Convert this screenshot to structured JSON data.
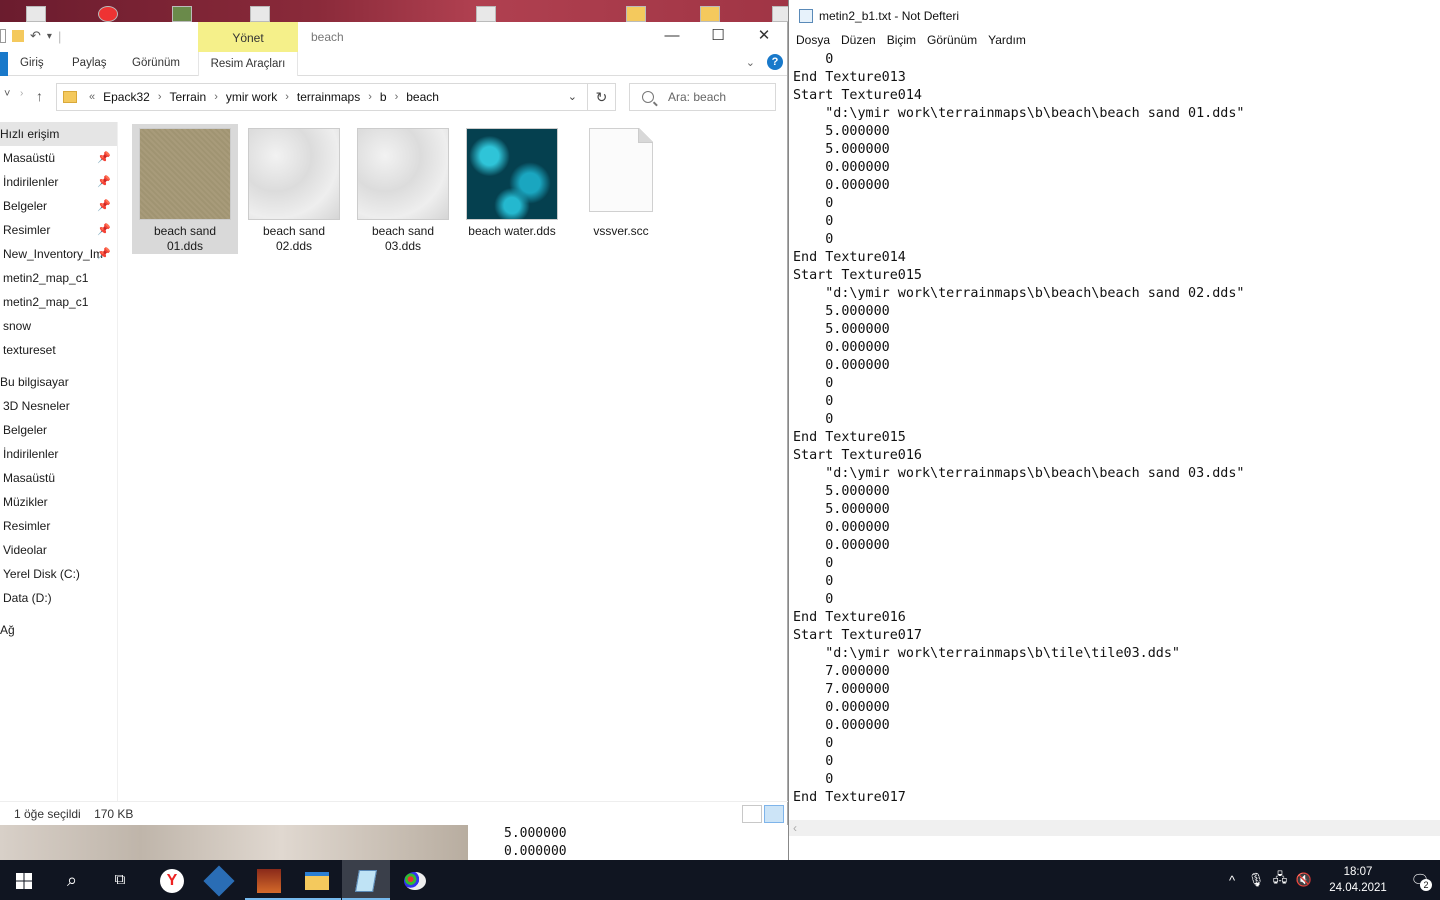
{
  "explorer": {
    "context_tab": "Yönet",
    "window_title": "beach",
    "ribbon_tabs": [
      "Giriş",
      "Paylaş",
      "Görünüm"
    ],
    "context_subtab": "Resim Araçları",
    "breadcrumbs": [
      "Epack32",
      "Terrain",
      "ymir work",
      "terrainmaps",
      "b",
      "beach"
    ],
    "search_placeholder": "Ara: beach",
    "nav_items": [
      {
        "label": "Hızlı erişim",
        "pinned": false,
        "selected": true
      },
      {
        "label": "Masaüstü",
        "pinned": true
      },
      {
        "label": "İndirilenler",
        "pinned": true
      },
      {
        "label": "Belgeler",
        "pinned": true
      },
      {
        "label": "Resimler",
        "pinned": true
      },
      {
        "label": "New_Inventory_Im",
        "pinned": true
      },
      {
        "label": "metin2_map_c1",
        "pinned": false
      },
      {
        "label": "metin2_map_c1",
        "pinned": false
      },
      {
        "label": "snow",
        "pinned": false
      },
      {
        "label": "textureset",
        "pinned": false
      },
      {
        "label": "Bu bilgisayar",
        "pinned": false
      },
      {
        "label": "3D Nesneler",
        "pinned": false
      },
      {
        "label": "Belgeler",
        "pinned": false
      },
      {
        "label": "İndirilenler",
        "pinned": false
      },
      {
        "label": "Masaüstü",
        "pinned": false
      },
      {
        "label": "Müzikler",
        "pinned": false
      },
      {
        "label": "Resimler",
        "pinned": false
      },
      {
        "label": "Videolar",
        "pinned": false
      },
      {
        "label": "Yerel Disk (C:)",
        "pinned": false
      },
      {
        "label": "Data (D:)",
        "pinned": false
      },
      {
        "label": "Ağ",
        "pinned": false
      }
    ],
    "files": [
      {
        "name": "beach sand 01.dds",
        "thumb": "sand-tan",
        "selected": true
      },
      {
        "name": "beach sand 02.dds",
        "thumb": "sand-white"
      },
      {
        "name": "beach sand 03.dds",
        "thumb": "sand-white"
      },
      {
        "name": "beach water.dds",
        "thumb": "water"
      },
      {
        "name": "vssver.scc",
        "thumb": "blank-file"
      }
    ],
    "status_selection": "1 öğe seçildi",
    "status_size": "170 KB"
  },
  "notepad": {
    "title": "metin2_b1.txt - Not Defteri",
    "menu": [
      "Dosya",
      "Düzen",
      "Biçim",
      "Görünüm",
      "Yardım"
    ],
    "lines": [
      "    0",
      "End Texture013",
      "Start Texture014",
      "    \"d:\\ymir work\\terrainmaps\\b\\beach\\beach sand 01.dds\"",
      "    5.000000",
      "    5.000000",
      "    0.000000",
      "    0.000000",
      "    0",
      "    0",
      "    0",
      "End Texture014",
      "Start Texture015",
      "    \"d:\\ymir work\\terrainmaps\\b\\beach\\beach sand 02.dds\"",
      "    5.000000",
      "    5.000000",
      "    0.000000",
      "    0.000000",
      "    0",
      "    0",
      "    0",
      "End Texture015",
      "Start Texture016",
      "    \"d:\\ymir work\\terrainmaps\\b\\beach\\beach sand 03.dds\"",
      "    5.000000",
      "    5.000000",
      "    0.000000",
      "    0.000000",
      "    0",
      "    0",
      "    0",
      "End Texture016",
      "Start Texture017",
      "    \"d:\\ymir work\\terrainmaps\\b\\tile\\tile03.dds\"",
      "    7.000000",
      "    7.000000",
      "    0.000000",
      "    0.000000",
      "    0",
      "    0",
      "    0",
      "End Texture017"
    ]
  },
  "background_notepad_lines": [
    "    5.000000",
    "    0.000000"
  ],
  "taskbar": {
    "apps": [
      "start",
      "search",
      "task-view",
      "yandex-browser",
      "virtualbox",
      "game",
      "file-explorer",
      "notepad",
      "paint"
    ],
    "clock_time": "18:07",
    "clock_date": "24.04.2021",
    "notification_count": "2"
  }
}
